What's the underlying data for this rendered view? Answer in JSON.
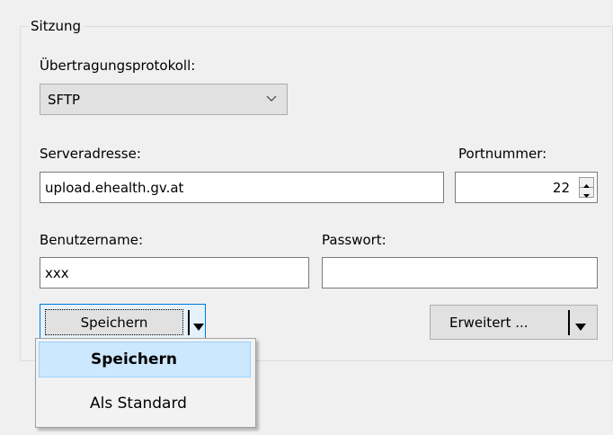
{
  "session": {
    "title": "Sitzung",
    "protocol": {
      "label": "Übertragungsprotokoll:",
      "selected": "SFTP"
    },
    "host": {
      "label": "Serveradresse:",
      "value": "upload.ehealth.gv.at"
    },
    "port": {
      "label": "Portnummer:",
      "value": "22"
    },
    "user": {
      "label": "Benutzername:",
      "value": "xxx"
    },
    "password": {
      "label": "Passwort:",
      "value": ""
    },
    "save_button": {
      "label": "Speichern"
    },
    "advanced_button": {
      "label": "Erweitert ..."
    },
    "save_menu": {
      "items": [
        {
          "label": "Speichern",
          "highlighted": true
        },
        {
          "label": "Als Standard",
          "highlighted": false
        }
      ]
    }
  },
  "icons": {
    "combo": "chevron-down-icon",
    "split": "triangle-down-icon",
    "spinner_up": "arrow-up-icon",
    "spinner_down": "arrow-down-icon"
  },
  "colors": {
    "background": "#f0f0f0",
    "focus_border": "#0078d7",
    "menu_highlight": "#cce8ff"
  }
}
